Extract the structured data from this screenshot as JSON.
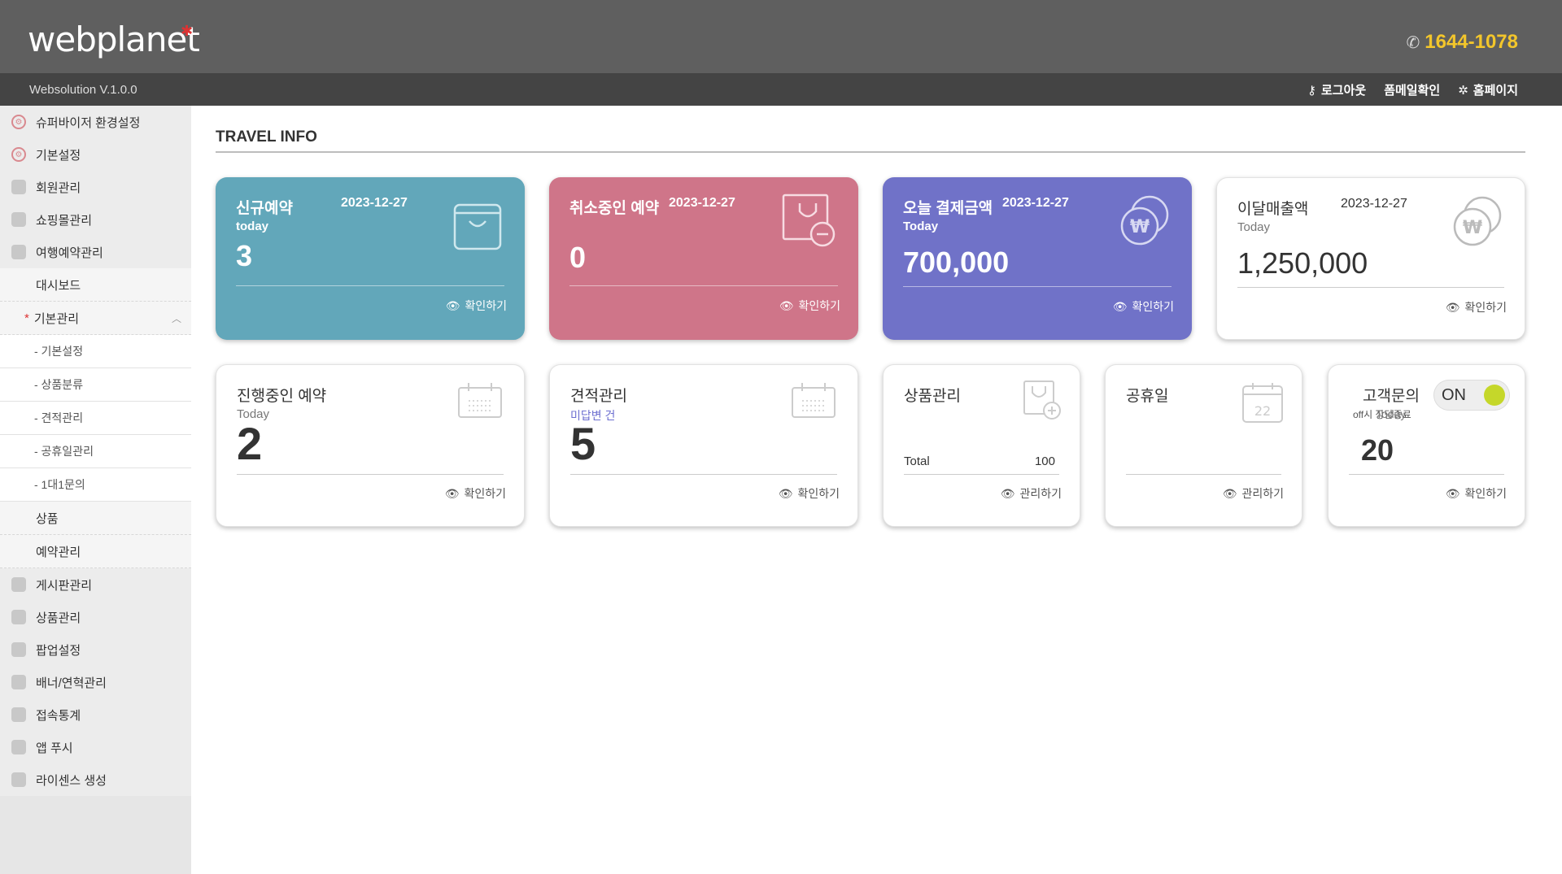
{
  "header": {
    "logo": "webplanet",
    "phone": "1644-1078"
  },
  "subbar": {
    "version": "Websolution V.1.0.0",
    "logout": "로그아웃",
    "form_mail": "폼메일확인",
    "homepage": "홈페이지"
  },
  "sidebar": {
    "items_top": [
      "슈퍼바이저 환경설정",
      "기본설정",
      "회원관리",
      "쇼핑몰관리",
      "여행예약관리"
    ],
    "dashboard": "대시보드",
    "basic_mgmt": "기본관리",
    "sub_items": [
      "- 기본설정",
      "- 상품분류",
      "- 견적관리",
      "- 공휴일관리",
      "- 1대1문의"
    ],
    "product": "상품",
    "reservation": "예약관리",
    "items_bottom": [
      "게시판관리",
      "상품관리",
      "팝업설정",
      "배너/연혁관리",
      "접속통계",
      "앱 푸시",
      "라이센스 생성"
    ]
  },
  "main": {
    "title": "TRAVEL INFO"
  },
  "cards": {
    "new_res": {
      "title": "신규예약",
      "date": "2023-12-27",
      "sub": "today",
      "value": "3",
      "link": "확인하기"
    },
    "cancel_res": {
      "title": "취소중인 예약",
      "date": "2023-12-27",
      "value": "0",
      "link": "확인하기"
    },
    "today_pay": {
      "title": "오늘 결제금액",
      "date": "2023-12-27",
      "sub": "Today",
      "value": "700,000",
      "link": "확인하기"
    },
    "month_sales": {
      "title": "이달매출액",
      "date": "2023-12-27",
      "sub": "Today",
      "value": "1,250,000",
      "link": "확인하기"
    },
    "ongoing": {
      "title": "진행중인 예약",
      "sub": "Today",
      "value": "2",
      "link": "확인하기"
    },
    "quote": {
      "title": "견적관리",
      "sub": "미답변 건",
      "value": "5",
      "link": "확인하기"
    },
    "product": {
      "title": "상품관리",
      "total_label": "Total",
      "total_value": "100",
      "link": "관리하기"
    },
    "holiday": {
      "title": "공휴일",
      "link": "관리하기"
    },
    "inquiry": {
      "title": "고객문의",
      "overlap_text": "off시 상담종료",
      "sub": "Today",
      "value": "20",
      "toggle": "ON",
      "link": "확인하기"
    }
  },
  "colors": {
    "teal": "#62a7ba",
    "pink": "#cf7589",
    "purple": "#7072c8",
    "header": "#5f5f5f",
    "phone": "#f3c62b"
  }
}
